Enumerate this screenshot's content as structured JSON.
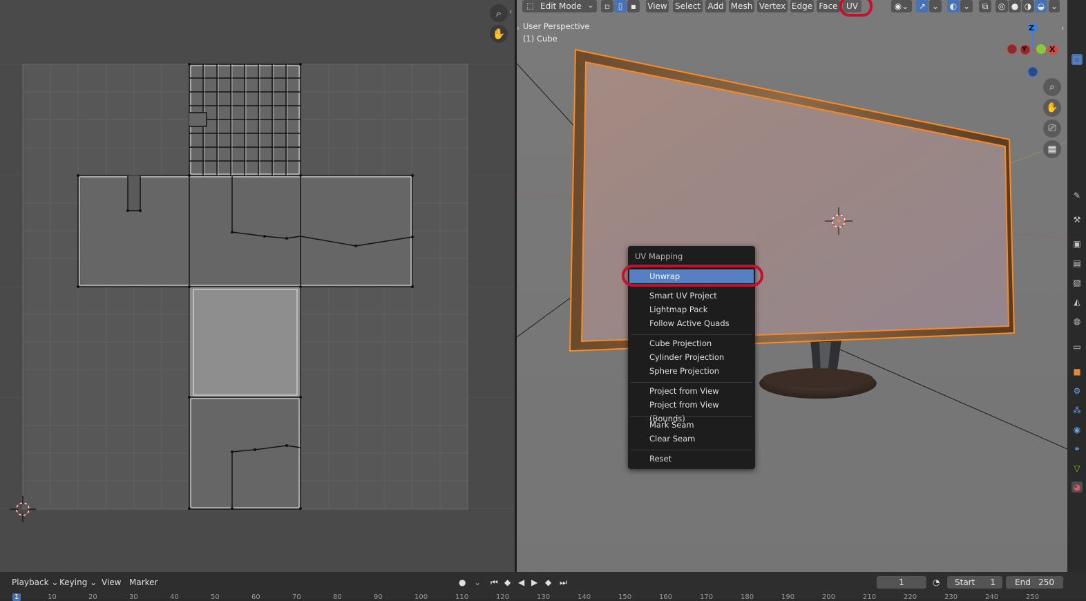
{
  "header": {
    "mode": "Edit Mode",
    "menus": [
      "View",
      "Select",
      "Add",
      "Mesh",
      "Vertex",
      "Edge",
      "Face",
      "UV"
    ],
    "active_menu": "UV"
  },
  "viewport": {
    "perspective_label": "User Perspective",
    "object_label": "(1) Cube",
    "gizmo_axes": {
      "z": "Z",
      "y": "Y",
      "x": "X"
    }
  },
  "uv_menu": {
    "title": "UV Mapping",
    "groups": [
      [
        "Unwrap"
      ],
      [
        "Smart UV Project",
        "Lightmap Pack",
        "Follow Active Quads"
      ],
      [
        "Cube Projection",
        "Cylinder Projection",
        "Sphere Projection"
      ],
      [
        "Project from View",
        "Project from View (Bounds)"
      ],
      [
        "Mark Seam",
        "Clear Seam"
      ],
      [
        "Reset"
      ]
    ],
    "highlighted": "Unwrap"
  },
  "timeline": {
    "menus": [
      "Playback",
      "Keying",
      "View",
      "Marker"
    ],
    "current_frame": "1",
    "start_label": "Start",
    "start_value": "1",
    "end_label": "End",
    "end_value": "250",
    "ruler": [
      "1",
      "10",
      "20",
      "30",
      "40",
      "50",
      "60",
      "70",
      "80",
      "90",
      "100",
      "110",
      "120",
      "130",
      "140",
      "150",
      "160",
      "170",
      "180",
      "190",
      "200",
      "210",
      "220",
      "230",
      "240",
      "250"
    ]
  },
  "colors": {
    "selection_outline": "#ff8a1f",
    "highlight": "#5680c2",
    "annotation_red": "#c4102c"
  },
  "icons": [
    "zoom-icon",
    "hand-icon",
    "camera-icon",
    "grid-icon",
    "cursor-icon"
  ]
}
